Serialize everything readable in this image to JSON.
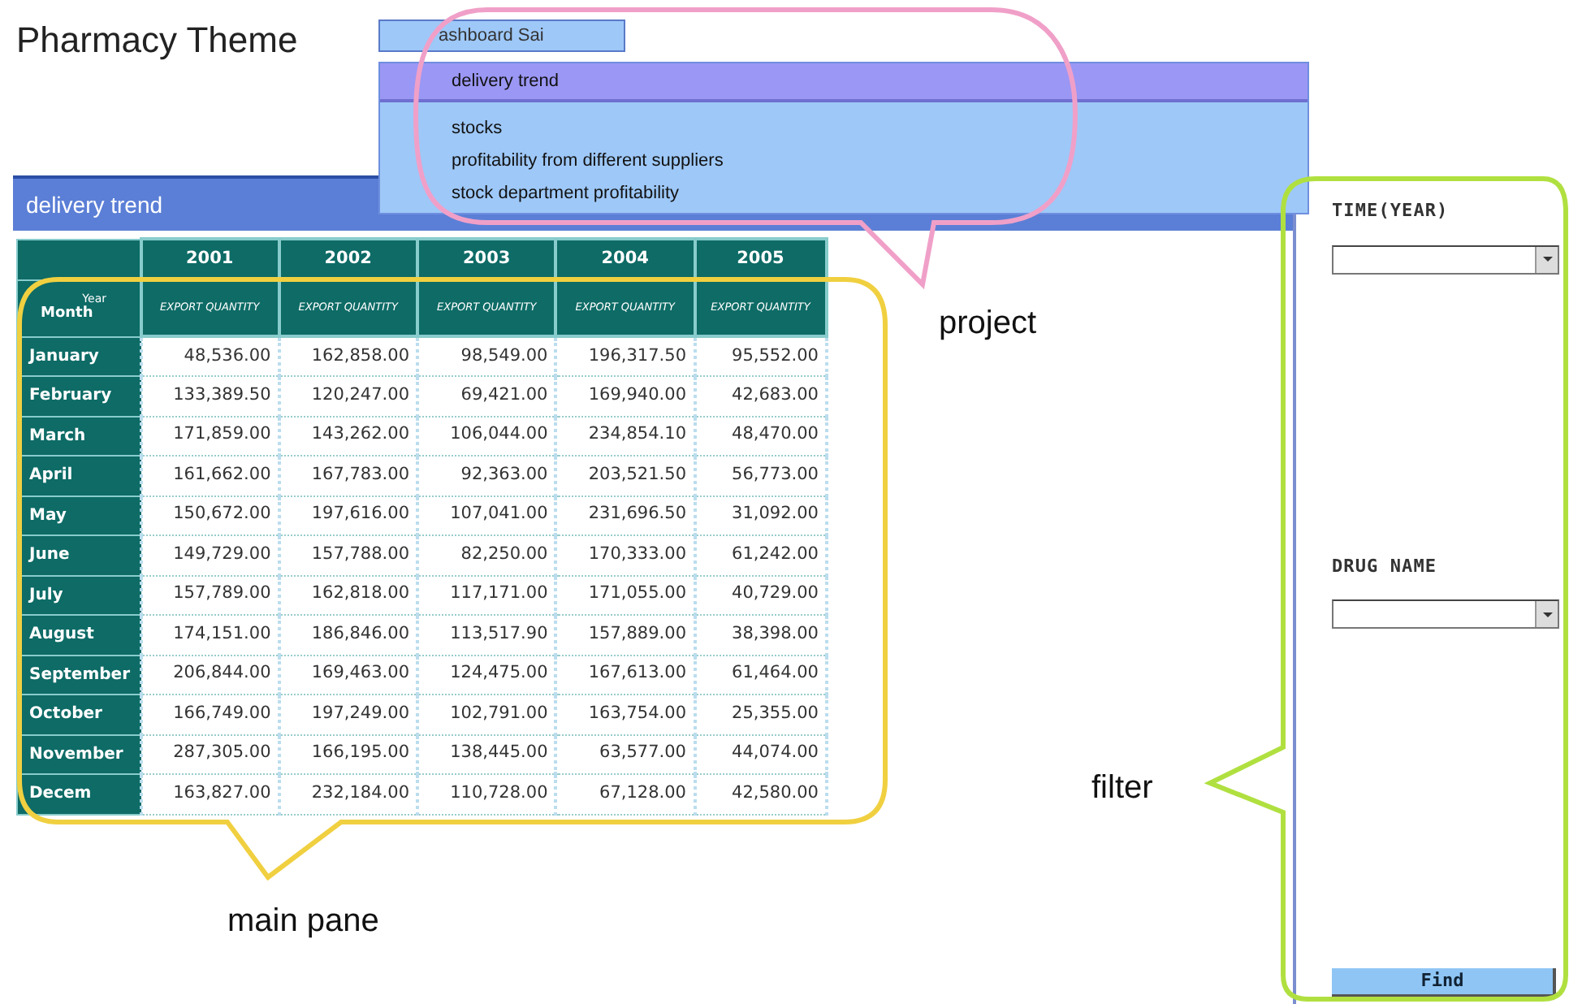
{
  "title": "Pharmacy Theme",
  "dashboard_field": {
    "value": "ashboard Sai"
  },
  "project_menu": [
    {
      "label": "delivery trend",
      "selected": true
    },
    {
      "label": "stocks",
      "selected": false
    },
    {
      "label": "profitability from different suppliers",
      "selected": false
    },
    {
      "label": "stock department profitability",
      "selected": false
    }
  ],
  "main_pane": {
    "title": "delivery trend",
    "table": {
      "corner_top": "Year",
      "corner_bottom": "Month",
      "years": [
        "2001",
        "2002",
        "2003",
        "2004",
        "2005"
      ],
      "measures": [
        "EXPORT QUANTITY",
        "EXPORT QUANTITY",
        "EXPORT QUANTITY",
        "EXPORT QUANTITY",
        "EXPORT QUANTITY"
      ],
      "rows": [
        {
          "month": "January",
          "values": [
            "48,536.00",
            "162,858.00",
            "98,549.00",
            "196,317.50",
            "95,552.00"
          ]
        },
        {
          "month": "February",
          "values": [
            "133,389.50",
            "120,247.00",
            "69,421.00",
            "169,940.00",
            "42,683.00"
          ]
        },
        {
          "month": "March",
          "values": [
            "171,859.00",
            "143,262.00",
            "106,044.00",
            "234,854.10",
            "48,470.00"
          ]
        },
        {
          "month": "April",
          "values": [
            "161,662.00",
            "167,783.00",
            "92,363.00",
            "203,521.50",
            "56,773.00"
          ]
        },
        {
          "month": "May",
          "values": [
            "150,672.00",
            "197,616.00",
            "107,041.00",
            "231,696.50",
            "31,092.00"
          ]
        },
        {
          "month": "June",
          "values": [
            "149,729.00",
            "157,788.00",
            "82,250.00",
            "170,333.00",
            "61,242.00"
          ]
        },
        {
          "month": "July",
          "values": [
            "157,789.00",
            "162,818.00",
            "117,171.00",
            "171,055.00",
            "40,729.00"
          ]
        },
        {
          "month": "August",
          "values": [
            "174,151.00",
            "186,846.00",
            "113,517.90",
            "157,889.00",
            "38,398.00"
          ]
        },
        {
          "month": "September",
          "values": [
            "206,844.00",
            "169,463.00",
            "124,475.00",
            "167,613.00",
            "61,464.00"
          ]
        },
        {
          "month": "October",
          "values": [
            "166,749.00",
            "197,249.00",
            "102,791.00",
            "163,754.00",
            "25,355.00"
          ]
        },
        {
          "month": "November",
          "values": [
            "287,305.00",
            "166,195.00",
            "138,445.00",
            "63,577.00",
            "44,074.00"
          ]
        },
        {
          "month": "Decem",
          "values": [
            "163,827.00",
            "232,184.00",
            "110,728.00",
            "67,128.00",
            "42,580.00"
          ]
        }
      ]
    }
  },
  "filter": {
    "fields": [
      {
        "label": "TIME(YEAR)"
      },
      {
        "label": "DRUG NAME"
      }
    ],
    "button": "Find"
  },
  "annotations": [
    {
      "label": "project",
      "color": "#f0a0c8"
    },
    {
      "label": "main pane",
      "color": "#f0d040"
    },
    {
      "label": "filter",
      "color": "#b0e040"
    }
  ]
}
